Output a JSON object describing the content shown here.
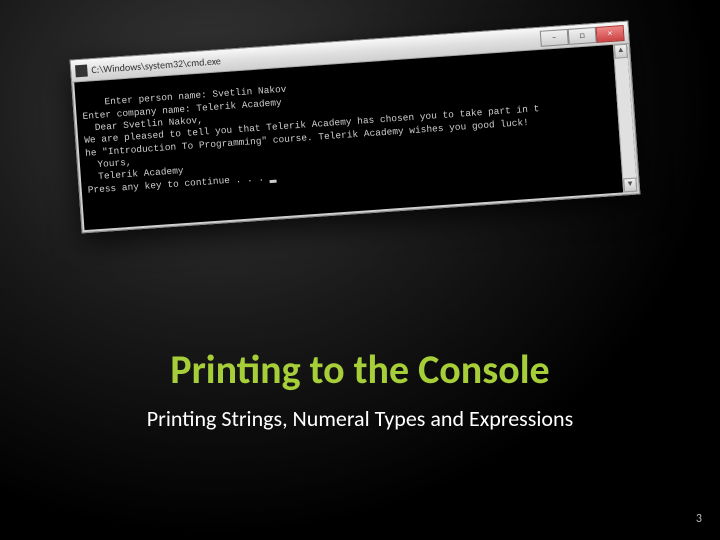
{
  "slide": {
    "title": "Printing to the Console",
    "subtitle": "Printing Strings, Numeral Types and Expressions",
    "page_number": "3"
  },
  "console": {
    "titlebar_path": "C:\\Windows\\system32\\cmd.exe",
    "lines": [
      "Enter person name: Svetlin Nakov",
      "Enter company name: Telerik Academy",
      "  Dear Svetlin Nakov,",
      "We are pleased to tell you that Telerik Academy has chosen you to take part in t",
      "he \"Introduction To Programming\" course. Telerik Academy wishes you good luck!",
      "  Yours,",
      "  Telerik Academy",
      "Press any key to continue . . . "
    ],
    "controls": {
      "minimize": "–",
      "maximize": "□",
      "close": "×"
    },
    "scroll_up": "▲",
    "scroll_down": "▼"
  }
}
